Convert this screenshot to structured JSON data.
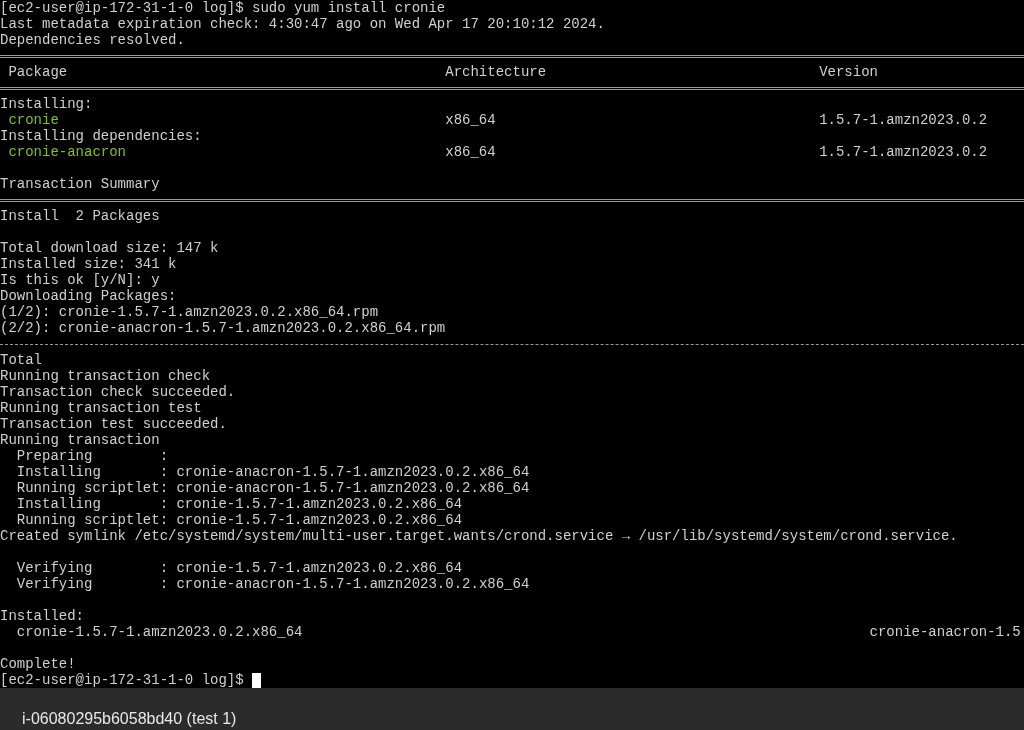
{
  "terminal": {
    "lines": [
      {
        "kind": "prompt",
        "prompt": "[ec2-user@ip-172-31-1-0 log]$",
        "command": "sudo yum install cronie",
        "cursor": false
      },
      {
        "kind": "text",
        "text": "Last metadata expiration check: 4:30:47 ago on Wed Apr 17 20:10:12 2024."
      },
      {
        "kind": "text",
        "text": "Dependencies resolved."
      },
      {
        "kind": "rule-double"
      },
      {
        "kind": "table-header",
        "columns": [
          "Package",
          "Architecture",
          "Version"
        ]
      },
      {
        "kind": "rule-double"
      },
      {
        "kind": "text",
        "text": "Installing:"
      },
      {
        "kind": "package-row",
        "name": "cronie",
        "arch": "x86_64",
        "version": "1.5.7-1.amzn2023.0.2"
      },
      {
        "kind": "text",
        "text": "Installing dependencies:"
      },
      {
        "kind": "package-row",
        "name": "cronie-anacron",
        "arch": "x86_64",
        "version": "1.5.7-1.amzn2023.0.2"
      },
      {
        "kind": "blank"
      },
      {
        "kind": "text",
        "text": "Transaction Summary"
      },
      {
        "kind": "rule-double"
      },
      {
        "kind": "text",
        "text": "Install  2 Packages"
      },
      {
        "kind": "blank"
      },
      {
        "kind": "text",
        "text": "Total download size: 147 k"
      },
      {
        "kind": "text",
        "text": "Installed size: 341 k"
      },
      {
        "kind": "text",
        "text": "Is this ok [y/N]: y"
      },
      {
        "kind": "text",
        "text": "Downloading Packages:"
      },
      {
        "kind": "text",
        "text": "(1/2): cronie-1.5.7-1.amzn2023.0.2.x86_64.rpm"
      },
      {
        "kind": "text",
        "text": "(2/2): cronie-anacron-1.5.7-1.amzn2023.0.2.x86_64.rpm"
      },
      {
        "kind": "rule-dashed"
      },
      {
        "kind": "text",
        "text": "Total"
      },
      {
        "kind": "text",
        "text": "Running transaction check"
      },
      {
        "kind": "text",
        "text": "Transaction check succeeded."
      },
      {
        "kind": "text",
        "text": "Running transaction test"
      },
      {
        "kind": "text",
        "text": "Transaction test succeeded."
      },
      {
        "kind": "text",
        "text": "Running transaction"
      },
      {
        "kind": "text",
        "text": "  Preparing        :"
      },
      {
        "kind": "text",
        "text": "  Installing       : cronie-anacron-1.5.7-1.amzn2023.0.2.x86_64"
      },
      {
        "kind": "text",
        "text": "  Running scriptlet: cronie-anacron-1.5.7-1.amzn2023.0.2.x86_64"
      },
      {
        "kind": "text",
        "text": "  Installing       : cronie-1.5.7-1.amzn2023.0.2.x86_64"
      },
      {
        "kind": "text",
        "text": "  Running scriptlet: cronie-1.5.7-1.amzn2023.0.2.x86_64"
      },
      {
        "kind": "text",
        "text": "Created symlink /etc/systemd/system/multi-user.target.wants/crond.service → /usr/lib/systemd/system/crond.service."
      },
      {
        "kind": "blank"
      },
      {
        "kind": "text",
        "text": "  Verifying        : cronie-1.5.7-1.amzn2023.0.2.x86_64"
      },
      {
        "kind": "text",
        "text": "  Verifying        : cronie-anacron-1.5.7-1.amzn2023.0.2.x86_64"
      },
      {
        "kind": "blank"
      },
      {
        "kind": "text",
        "text": "Installed:"
      },
      {
        "kind": "installed-row",
        "items": [
          "cronie-1.5.7-1.amzn2023.0.2.x86_64",
          "cronie-anacron-1.5"
        ]
      },
      {
        "kind": "blank"
      },
      {
        "kind": "text",
        "text": "Complete!"
      },
      {
        "kind": "prompt",
        "prompt": "[ec2-user@ip-172-31-1-0 log]$",
        "cursor": true
      }
    ]
  },
  "footer": {
    "instance": "i-06080295b6058bd40 (test 1)"
  }
}
